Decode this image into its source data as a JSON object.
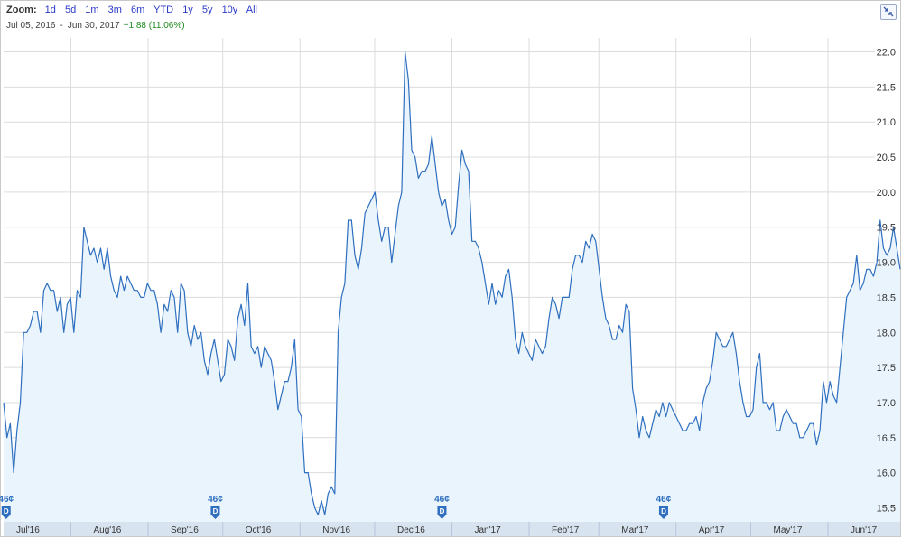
{
  "zoom": {
    "label": "Zoom:",
    "options": [
      "1d",
      "5d",
      "1m",
      "3m",
      "6m",
      "YTD",
      "1y",
      "5y",
      "10y",
      "All"
    ]
  },
  "range": {
    "start": "Jul 05, 2016",
    "separator": "-",
    "end": "Jun 30, 2017",
    "change": "+1.88 (11.06%)"
  },
  "colors": {
    "line": "#2e6fbf",
    "fill": "#eaf4fc",
    "grid": "#dcdcdc",
    "axis_band": "#d8e3f0",
    "marker": "#2e6fbf",
    "change_positive": "#1e8a1e",
    "zoom_link": "#2a39c8"
  },
  "reset_icon": "collapse-arrows-icon",
  "chart_data": {
    "type": "area",
    "x_start": "2016-07-05",
    "x_end": "2017-06-30",
    "ylim": [
      15.3,
      22.2
    ],
    "y_ticks": [
      15.5,
      16.0,
      16.5,
      17.0,
      17.5,
      18.0,
      18.5,
      19.0,
      19.5,
      20.0,
      20.5,
      21.0,
      21.5,
      22.0
    ],
    "x_tick_labels": [
      "Jul'16",
      "Aug'16",
      "Sep'16",
      "Oct'16",
      "Nov'16",
      "Dec'16",
      "Jan'17",
      "Feb'17",
      "Mar'17",
      "Apr'17",
      "May'17",
      "Jun'17"
    ],
    "grid": true,
    "series": [
      {
        "values": [
          17.0,
          16.5,
          16.7,
          16.0,
          16.6,
          17.0,
          18.0,
          18.0,
          18.1,
          18.3,
          18.3,
          18.0,
          18.6,
          18.7,
          18.6,
          18.6,
          18.3,
          18.5,
          18.0,
          18.4,
          18.5,
          18.0,
          18.6,
          18.5,
          19.5,
          19.3,
          19.1,
          19.2,
          19.0,
          19.2,
          18.9,
          19.2,
          18.8,
          18.6,
          18.5,
          18.8,
          18.6,
          18.8,
          18.7,
          18.6,
          18.6,
          18.5,
          18.5,
          18.7,
          18.6,
          18.6,
          18.4,
          18.0,
          18.4,
          18.3,
          18.6,
          18.5,
          18.0,
          18.7,
          18.6,
          18.0,
          17.8,
          18.1,
          17.9,
          18.0,
          17.6,
          17.4,
          17.7,
          17.9,
          17.6,
          17.3,
          17.4,
          17.9,
          17.8,
          17.6,
          18.2,
          18.4,
          18.1,
          18.7,
          17.8,
          17.7,
          17.8,
          17.5,
          17.8,
          17.7,
          17.6,
          17.3,
          16.9,
          17.1,
          17.3,
          17.3,
          17.5,
          17.9,
          16.9,
          16.8,
          16.0,
          16.0,
          15.7,
          15.5,
          15.4,
          15.6,
          15.4,
          15.7,
          15.8,
          15.7,
          18.0,
          18.5,
          18.7,
          19.6,
          19.6,
          19.1,
          18.9,
          19.2,
          19.7,
          19.8,
          19.9,
          20.0,
          19.6,
          19.3,
          19.5,
          19.5,
          19.0,
          19.4,
          19.8,
          20.0,
          22.0,
          21.6,
          20.6,
          20.5,
          20.2,
          20.3,
          20.3,
          20.4,
          20.8,
          20.4,
          20.0,
          19.8,
          19.9,
          19.6,
          19.4,
          19.5,
          20.1,
          20.6,
          20.4,
          20.3,
          19.3,
          19.3,
          19.2,
          19.0,
          18.7,
          18.4,
          18.7,
          18.4,
          18.6,
          18.5,
          18.8,
          18.9,
          18.5,
          17.9,
          17.7,
          18.0,
          17.8,
          17.7,
          17.6,
          17.9,
          17.8,
          17.7,
          17.8,
          18.2,
          18.5,
          18.4,
          18.2,
          18.5,
          18.5,
          18.5,
          18.9,
          19.1,
          19.1,
          19.0,
          19.3,
          19.2,
          19.4,
          19.3,
          18.9,
          18.5,
          18.2,
          18.1,
          17.9,
          17.9,
          18.1,
          18.0,
          18.4,
          18.3,
          17.2,
          16.9,
          16.5,
          16.8,
          16.6,
          16.5,
          16.7,
          16.9,
          16.8,
          17.0,
          16.8,
          17.0,
          16.9,
          16.8,
          16.7,
          16.6,
          16.6,
          16.7,
          16.7,
          16.8,
          16.6,
          17.0,
          17.2,
          17.3,
          17.6,
          18.0,
          17.9,
          17.8,
          17.8,
          17.9,
          18.0,
          17.7,
          17.3,
          17.0,
          16.8,
          16.8,
          16.9,
          17.5,
          17.7,
          17.0,
          17.0,
          16.9,
          17.0,
          16.6,
          16.6,
          16.8,
          16.9,
          16.8,
          16.7,
          16.7,
          16.5,
          16.5,
          16.6,
          16.7,
          16.7,
          16.4,
          16.6,
          17.3,
          17.0,
          17.3,
          17.1,
          17.0,
          17.5,
          18.0,
          18.5,
          18.6,
          18.7,
          19.1,
          18.6,
          18.7,
          18.9,
          18.9,
          18.8,
          19.0,
          19.6,
          19.2,
          19.1,
          19.2,
          19.5,
          19.2,
          18.9
        ]
      }
    ],
    "dividends": [
      {
        "date": "2016-07-06",
        "label": "46¢",
        "icon": "D"
      },
      {
        "date": "2016-09-28",
        "label": "46¢",
        "icon": "D"
      },
      {
        "date": "2016-12-28",
        "label": "46¢",
        "icon": "D"
      },
      {
        "date": "2017-03-27",
        "label": "46¢",
        "icon": "D"
      }
    ]
  }
}
